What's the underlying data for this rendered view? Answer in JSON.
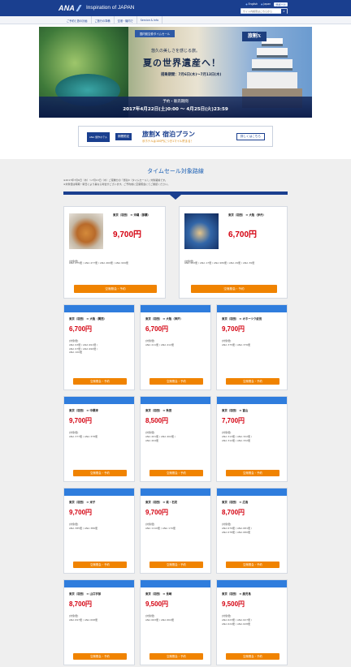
{
  "header": {
    "brand": "ANA",
    "site_title": "Inspiration of JAPAN",
    "links": [
      "English",
      "Japan",
      "サポート"
    ],
    "search_placeholder": "サイト内検索はこちらから"
  },
  "nav": [
    "ご予約と旅の計画",
    "ご旅行の準備",
    "空港・機内で",
    "Service & Info"
  ],
  "hero": {
    "tag": "国内航空券タイムセール",
    "logo_text": "旅割X",
    "subtitle": "悠久の美しさを感じる旅。",
    "catch": "夏の世界遺産へ！",
    "period": "搭乗期間：7月6日(木)〜7月13日(木)",
    "sale_label": "予約・販売期間",
    "sale_period": "2017年4月22日(土)0:00 〜 4月25日(火)23:59"
  },
  "promo": {
    "hotel": "ANA 旅作ホテル",
    "limited": "期間限定",
    "plan": "旅割X 宿泊プラン",
    "plan_sub": "＠ホテルは100円につき1マイル貯まる！",
    "more": "詳しくはこちら"
  },
  "section": {
    "title": "タイムセール対象路線",
    "notes": [
      "※2017年7月6日（木）〜7月13日（木）ご搭乗分の「旅割X（タイムセール）」対象路線です。",
      "※対象便は時期・曜日により異なる場合がございます。ご予約前に空席照会にてご確認ください。"
    ]
  },
  "button_label": "空席照会・予約",
  "flight_label": "[対象便]",
  "featured": [
    {
      "route": "東京（羽田） ⇔ 沖縄（那覇）",
      "price": "9,700円",
      "flights": "ANA 475便 / ANA 477便 / ANA 469便 / ANA 999便"
    },
    {
      "route": "東京（羽田） ⇔ 大阪（伊丹）",
      "price": "6,700円",
      "flights": "ANA 993便 / ANA 17便 / ANA 989便 / ANA 29便 / ANA 39便"
    }
  ],
  "routes": [
    {
      "route": "東京（羽田） ⇔ 大阪（関西）",
      "price": "6,700円",
      "flights": [
        "ANA 93便 / ANA 991便 /",
        "ANA 97便 / ANA 990便 /",
        "ANA 100便"
      ]
    },
    {
      "route": "東京（羽田） ⇔ 大阪（神戸）",
      "price": "6,700円",
      "flights": [
        "ANA 411便 / ANA 412便"
      ]
    },
    {
      "route": "東京（羽田） ⇔ オホーツク紋別",
      "price": "9,700円",
      "flights": [
        "ANA 375便 / ANA 376便"
      ]
    },
    {
      "route": "東京（羽田） ⇔ 中標津",
      "price": "9,700円",
      "flights": [
        "ANA 377便 / ANA 378便"
      ]
    },
    {
      "route": "東京（羽田） ⇔ 秋田",
      "price": "8,500円",
      "flights": [
        "ANA 401便 / ANA 402便 /",
        "ANA 404便"
      ]
    },
    {
      "route": "東京（羽田） ⇔ 富山",
      "price": "7,700円",
      "flights": [
        "ANA 313便 / ANA 322便 /",
        "ANA 312便 / ANA 332便"
      ]
    },
    {
      "route": "東京（羽田） ⇔ 米子",
      "price": "9,700円",
      "flights": [
        "ANA 385便 / ANA 386便"
      ]
    },
    {
      "route": "東京（羽田） ⇔ 萩・石見",
      "price": "9,700円",
      "flights": [
        "ANA 1110便 / ANA 170便"
      ]
    },
    {
      "route": "東京（羽田） ⇔ 広島",
      "price": "8,700円",
      "flights": [
        "ANA 679便 / ANA 681便 /",
        "ANA 678便 / ANA 680便"
      ]
    },
    {
      "route": "東京（羽田） ⇔ 山口宇部",
      "price": "8,700円",
      "flights": [
        "ANA 697便 / ANA 698便"
      ]
    },
    {
      "route": "東京（羽田） ⇔ 長崎",
      "price": "9,500円",
      "flights": [
        "ANA 663便 / ANA 664便"
      ]
    },
    {
      "route": "東京（羽田） ⇔ 鹿児島",
      "price": "9,500円",
      "flights": [
        "ANA 623便 / ANA 627便 /",
        "ANA 624便 / ANA 628便"
      ]
    }
  ]
}
